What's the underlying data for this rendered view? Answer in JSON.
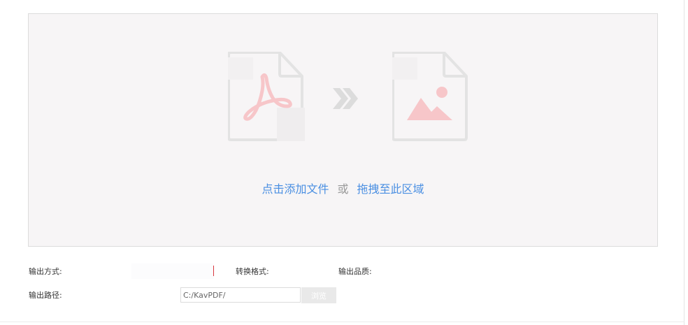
{
  "drop_zone": {
    "add_file_link": "点击添加文件",
    "or_text": "或",
    "drag_here_link": "拖拽至此区域",
    "source_icon": "pdf-file-icon",
    "arrow_icon": "double-chevron-right-icon",
    "target_icon": "image-file-icon"
  },
  "settings": {
    "output_mode_label": "输出方式:",
    "convert_format_label": "转换格式:",
    "output_quality_label": "输出品质:",
    "output_path_label": "输出路径:",
    "output_path_value": "C:/KavPDF/",
    "browse_label": "浏览"
  },
  "colors": {
    "link": "#4a8fe2",
    "icon_outline": "#e3e3e3",
    "icon_accent": "#f7c6c9",
    "drop_zone_bg": "#f7f5f6"
  }
}
